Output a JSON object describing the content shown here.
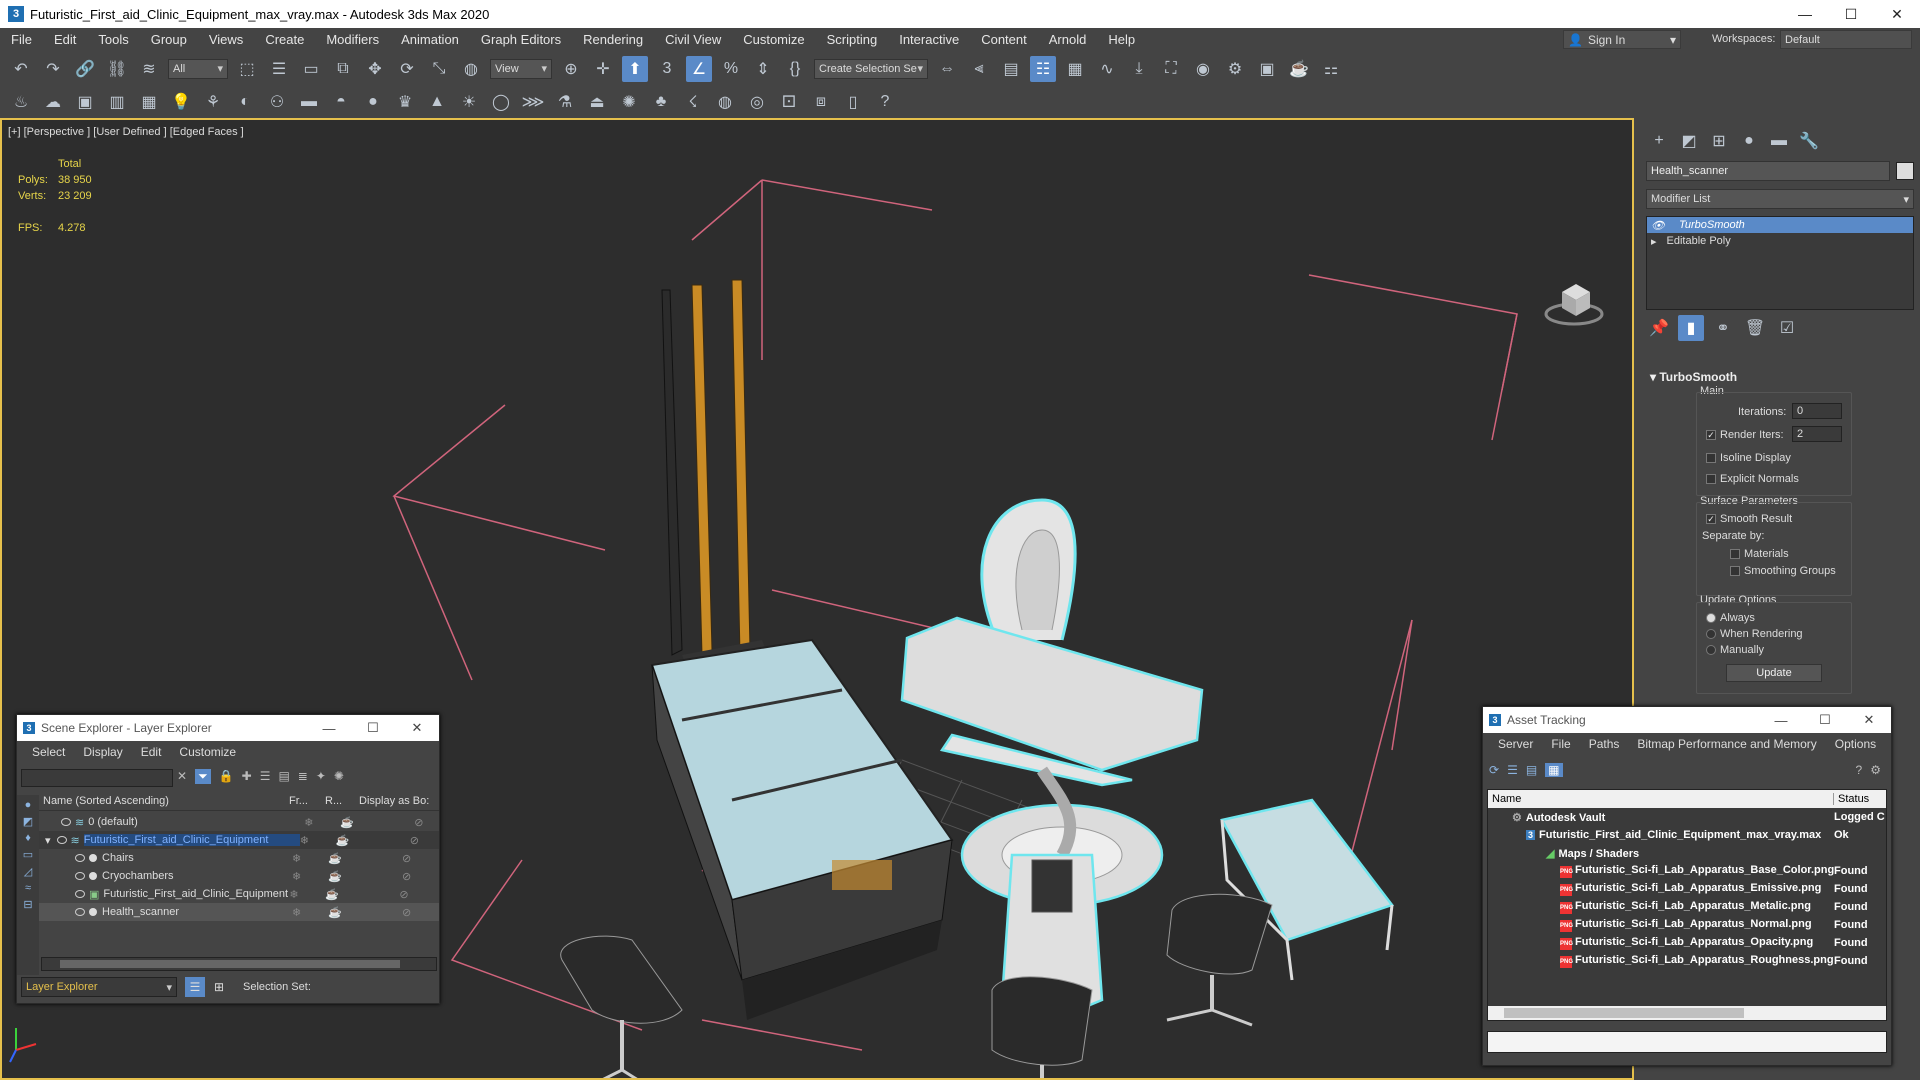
{
  "window": {
    "title": "Futuristic_First_aid_Clinic_Equipment_max_vray.max - Autodesk 3ds Max 2020",
    "app_icon": "3"
  },
  "menu": [
    "File",
    "Edit",
    "Tools",
    "Group",
    "Views",
    "Create",
    "Modifiers",
    "Animation",
    "Graph Editors",
    "Rendering",
    "Civil View",
    "Customize",
    "Scripting",
    "Interactive",
    "Content",
    "Arnold",
    "Help"
  ],
  "account": {
    "signin": "Sign In",
    "workspaces_label": "Workspaces:",
    "workspace": "Default"
  },
  "toolbar": {
    "filter": "All",
    "ref_coord": "View",
    "selection_set": "Create Selection Se"
  },
  "viewport": {
    "label": "[+] [Perspective ] [User Defined ] [Edged Faces ]",
    "stats_header": "Total",
    "polys_label": "Polys:",
    "polys": "38 950",
    "verts_label": "Verts:",
    "verts": "23 209",
    "fps_label": "FPS:",
    "fps": "4.278"
  },
  "command_panel": {
    "object_name": "Health_scanner",
    "modifier_list": "Modifier List",
    "stack": [
      "TurboSmooth",
      "Editable Poly"
    ],
    "rollout_title": "TurboSmooth",
    "main_label": "Main",
    "iterations_label": "Iterations:",
    "iterations": "0",
    "render_iters_label": "Render Iters:",
    "render_iters": "2",
    "isoline": "Isoline Display",
    "explicit_normals": "Explicit Normals",
    "surface_params": "Surface Parameters",
    "smooth_result": "Smooth Result",
    "separate_by": "Separate by:",
    "materials": "Materials",
    "smoothing_groups": "Smoothing Groups",
    "update_options": "Update Options",
    "always": "Always",
    "when_rendering": "When Rendering",
    "manually": "Manually",
    "update_button": "Update"
  },
  "scene_explorer": {
    "title": "Scene Explorer - Layer Explorer",
    "menu": [
      "Select",
      "Display",
      "Edit",
      "Customize"
    ],
    "columns": [
      "Name (Sorted Ascending)",
      "Fr...",
      "R...",
      "Display as Bo:"
    ],
    "rows": [
      {
        "name": "0 (default)",
        "indent": 1
      },
      {
        "name": "Futuristic_First_aid_Clinic_Equipment",
        "indent": 1,
        "selected": true
      },
      {
        "name": "Chairs",
        "indent": 2
      },
      {
        "name": "Cryochambers",
        "indent": 2
      },
      {
        "name": "Futuristic_First_aid_Clinic_Equipment",
        "indent": 2
      },
      {
        "name": "Health_scanner",
        "indent": 2,
        "highlight": true
      }
    ],
    "footer_explorer": "Layer Explorer",
    "selection_set_label": "Selection Set:"
  },
  "asset_tracking": {
    "title": "Asset Tracking",
    "menu": [
      "Server",
      "File",
      "Paths",
      "Bitmap Performance and Memory",
      "Options"
    ],
    "columns": [
      "Name",
      "Status"
    ],
    "rows": [
      {
        "name": "Autodesk Vault",
        "status": "Logged C",
        "indent": 1
      },
      {
        "name": "Futuristic_First_aid_Clinic_Equipment_max_vray.max",
        "status": "Ok",
        "indent": 2
      },
      {
        "name": "Maps / Shaders",
        "status": "",
        "indent": 3
      },
      {
        "name": "Futuristic_Sci-fi_Lab_Apparatus_Base_Color.png",
        "status": "Found",
        "indent": 4
      },
      {
        "name": "Futuristic_Sci-fi_Lab_Apparatus_Emissive.png",
        "status": "Found",
        "indent": 4
      },
      {
        "name": "Futuristic_Sci-fi_Lab_Apparatus_Metalic.png",
        "status": "Found",
        "indent": 4
      },
      {
        "name": "Futuristic_Sci-fi_Lab_Apparatus_Normal.png",
        "status": "Found",
        "indent": 4
      },
      {
        "name": "Futuristic_Sci-fi_Lab_Apparatus_Opacity.png",
        "status": "Found",
        "indent": 4
      },
      {
        "name": "Futuristic_Sci-fi_Lab_Apparatus_Roughness.png",
        "status": "Found",
        "indent": 4
      }
    ]
  },
  "colors": {
    "accent": "#5a8ac8",
    "viewport_border": "#e5c04c",
    "selection_wire": "#6fe6ee",
    "bbox": "#d0647c"
  }
}
